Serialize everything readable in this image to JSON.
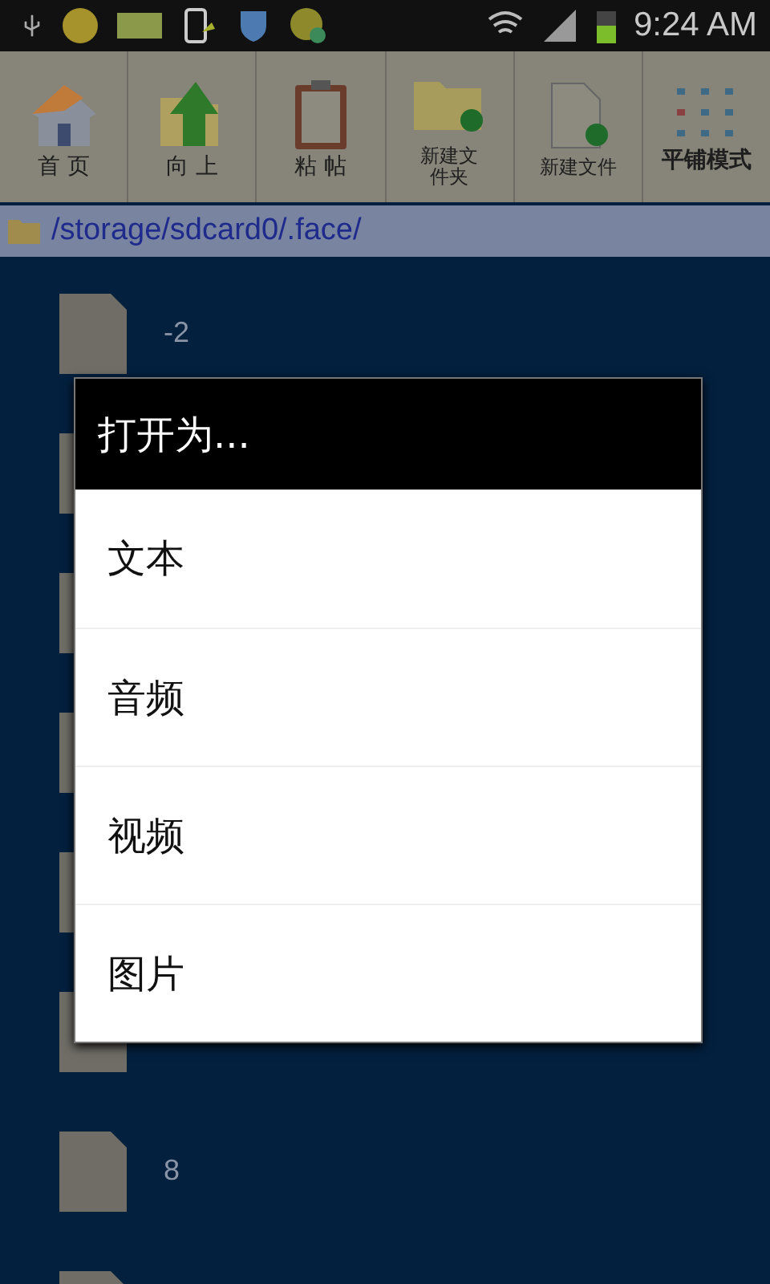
{
  "status_bar": {
    "time": "9:24 AM"
  },
  "toolbar": [
    {
      "kind": "home",
      "label": "首 页"
    },
    {
      "kind": "up",
      "label": "向 上"
    },
    {
      "kind": "paste",
      "label": "粘 帖"
    },
    {
      "kind": "new_folder",
      "label": "新建文件夹"
    },
    {
      "kind": "new_file",
      "label": "新建文件"
    },
    {
      "kind": "tile",
      "label": "平铺模式"
    }
  ],
  "path": "/storage/sdcard0/.face/",
  "files": [
    {
      "kind": "file",
      "name": "-2"
    },
    {
      "kind": "file"
    },
    {
      "kind": "file"
    },
    {
      "kind": "file"
    },
    {
      "kind": "file"
    },
    {
      "kind": "file"
    },
    {
      "kind": "file",
      "name": "8"
    },
    {
      "kind": "file"
    }
  ],
  "dialog": {
    "title": "打开为...",
    "options": [
      "文本",
      "音频",
      "视频",
      "图片"
    ]
  }
}
